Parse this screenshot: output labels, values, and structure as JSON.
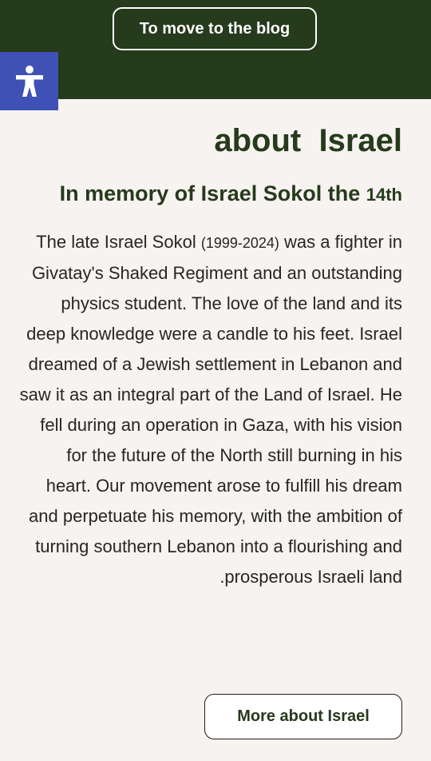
{
  "header": {
    "blog_button_label": "To move to the blog",
    "accessibility_icon": "accessibility-person-icon"
  },
  "main": {
    "title": "about  Israel",
    "subtitle_prefix": "In memory of Israel Sokol the ",
    "subtitle_number": "14th",
    "body_lead": "The late Israel Sokol ",
    "body_years": "(1999-2024)",
    "body_rest": " was a fighter in Givatay's Shaked Regiment and an outstanding physics student. The love of the land and its deep knowledge were a candle to his feet. Israel dreamed of a Jewish settlement in Lebanon and saw it as an integral part of the Land of Israel. He fell during an operation in Gaza, with his vision for the future of the North still burning in his heart. Our movement arose to fulfill his dream and perpetuate his memory, with the ambition of turning southern Lebanon into a flourishing and .prosperous Israeli land",
    "more_button_label": "More about Israel"
  },
  "colors": {
    "header_bg": "#263a1c",
    "page_bg": "#f6f3f0",
    "accessibility_bg": "#3f51b5",
    "heading": "#263a1c",
    "body_text": "#262626"
  }
}
